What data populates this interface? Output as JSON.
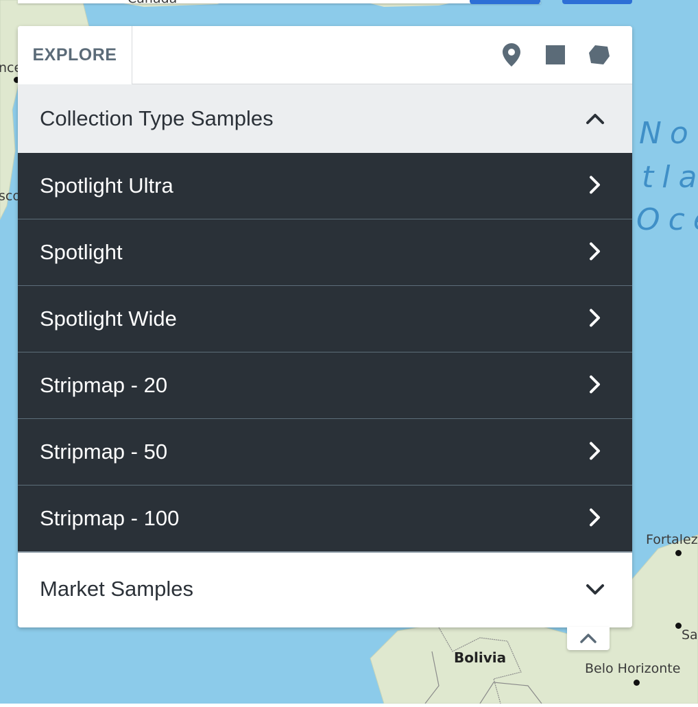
{
  "map": {
    "labels": {
      "top_fragment": "Canada",
      "left_fragment_1": "nce",
      "left_fragment_2": "sco",
      "ocean_line_1": "No",
      "ocean_line_2": "tla",
      "ocean_line_3": "Oce",
      "fortaleza": "Fortalez",
      "salvador": "Sa",
      "bolivia": "Bolivia",
      "belo_horizonte": "Belo Horizonte"
    },
    "colors": {
      "water": "#8ccbea",
      "land": "#dfe8cf",
      "border": "#8a8a8a"
    }
  },
  "panel": {
    "tab_label": "EXPLORE",
    "tools": [
      "point-tool",
      "rectangle-tool",
      "polygon-tool"
    ],
    "sections": [
      {
        "title": "Collection Type Samples",
        "state": "expanded",
        "items": [
          {
            "label": "Spotlight Ultra"
          },
          {
            "label": "Spotlight"
          },
          {
            "label": "Spotlight Wide"
          },
          {
            "label": "Stripmap - 20"
          },
          {
            "label": "Stripmap - 50"
          },
          {
            "label": "Stripmap - 100"
          }
        ]
      },
      {
        "title": "Market Samples",
        "state": "collapsed"
      }
    ],
    "colors": {
      "tool_icon": "#5b6b78",
      "item_bg": "#2a3138",
      "header_bg": "#eceef0"
    }
  }
}
